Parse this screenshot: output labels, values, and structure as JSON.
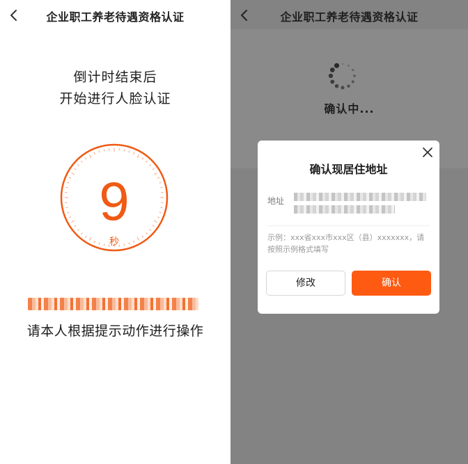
{
  "left": {
    "nav": {
      "title": "企业职工养老待遇资格认证"
    },
    "prompt": {
      "line1": "倒计时结束后",
      "line2": "开始进行人脸认证"
    },
    "countdown": {
      "number": "9",
      "unit": "秒",
      "accent_color": "#f05a14"
    },
    "instruction": "请本人根据提示动作进行操作"
  },
  "right": {
    "nav": {
      "title": "企业职工养老待遇资格认证"
    },
    "loading": {
      "text": "确认中..."
    },
    "dialog": {
      "title": "确认现居住地址",
      "address_label": "地址",
      "example_text": "示例：xxx省xxx市xxx区（县）xxxxxxx，请按照示例格式填写",
      "modify_label": "修改",
      "confirm_label": "确认",
      "confirm_color": "#ff5a12"
    }
  }
}
